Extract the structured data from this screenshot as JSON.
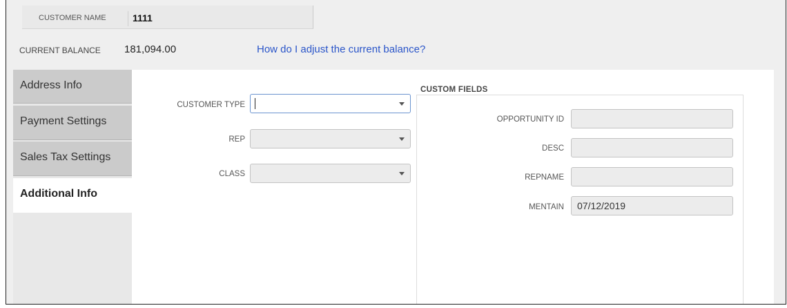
{
  "header": {
    "customer_name_label": "CUSTOMER NAME",
    "customer_name_value": "1111",
    "current_balance_label": "CURRENT BALANCE",
    "current_balance_value": "181,094.00",
    "help_link": "How do I adjust the current balance?"
  },
  "tabs": [
    {
      "label": "Address Info",
      "active": false
    },
    {
      "label": "Payment Settings",
      "active": false
    },
    {
      "label": "Sales Tax Settings",
      "active": false
    },
    {
      "label": "Additional Info",
      "active": true
    }
  ],
  "fields": {
    "customer_type": {
      "label": "CUSTOMER TYPE",
      "value": ""
    },
    "rep": {
      "label": "REP",
      "value": ""
    },
    "class": {
      "label": "CLASS",
      "value": ""
    }
  },
  "custom_fields": {
    "title": "CUSTOM FIELDS",
    "items": [
      {
        "label": "OPPORTUNITY ID",
        "value": ""
      },
      {
        "label": "DESC",
        "value": ""
      },
      {
        "label": "REPNAME",
        "value": ""
      },
      {
        "label": "MENTAIN",
        "value": "07/12/2019"
      }
    ]
  },
  "colors": {
    "link": "#2a55c9",
    "tab_inactive": "#cbcbcb",
    "focus_border": "#6a93cf"
  }
}
